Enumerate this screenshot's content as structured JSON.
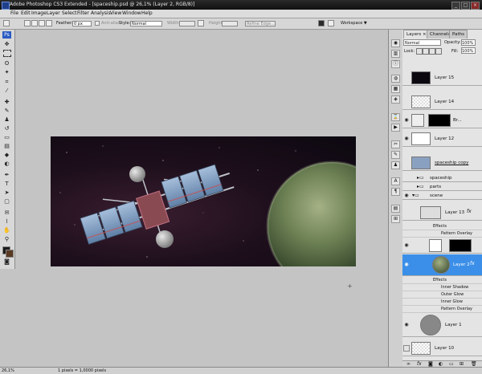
{
  "window": {
    "title": "Adobe Photoshop CS3 Extended - [spaceship.psd @ 26,1% (Layer 2, RGB/8)]",
    "controls": [
      "_",
      "□",
      "×"
    ]
  },
  "menu": [
    "File",
    "Edit",
    "Image",
    "Layer",
    "Select",
    "Filter",
    "Analysis",
    "View",
    "Window",
    "Help"
  ],
  "options": {
    "feather_label": "Feather:",
    "feather_value": "0 px",
    "antialias_label": "Anti-alias",
    "style_label": "Style:",
    "style_value": "Normal",
    "width_label": "Width:",
    "height_label": "Height:",
    "refine_label": "Refine Edge...",
    "workspace_label": "Workspace ▼"
  },
  "status": {
    "zoom": "26,1%",
    "doc_info": "1 pixels = 1,0000 pixels"
  },
  "panel": {
    "tabs": [
      "Layers ×",
      "Channels",
      "Paths"
    ],
    "blend_mode": "Normal",
    "opacity_label": "Opacity:",
    "opacity_value": "100%",
    "lock_label": "Lock:",
    "fill_label": "Fill:",
    "fill_value": "100%"
  },
  "layers": [
    {
      "name": "Layer 15"
    },
    {
      "name": "Layer 14"
    },
    {
      "name": "Br..."
    },
    {
      "name": "Layer 12"
    },
    {
      "name": "spaceship copy"
    },
    {
      "name": "spaceship"
    },
    {
      "name": "parts"
    },
    {
      "name": "scene"
    },
    {
      "name": "Layer 13",
      "fx": "fx"
    },
    {
      "name": "Effects"
    },
    {
      "name": "Pattern Overlay"
    },
    {
      "name": "Layer 2",
      "fx": "fx"
    },
    {
      "name": "Effects"
    },
    {
      "name": "Inner Shadow"
    },
    {
      "name": "Outer Glow"
    },
    {
      "name": "Inner Glow"
    },
    {
      "name": "Pattern Overlay"
    },
    {
      "name": "Layer 1"
    },
    {
      "name": "Layer 10"
    }
  ],
  "colors": {
    "selected_layer": "#3b8fe8",
    "foreground": "#1a1a1a",
    "background": "#5a3a22"
  }
}
